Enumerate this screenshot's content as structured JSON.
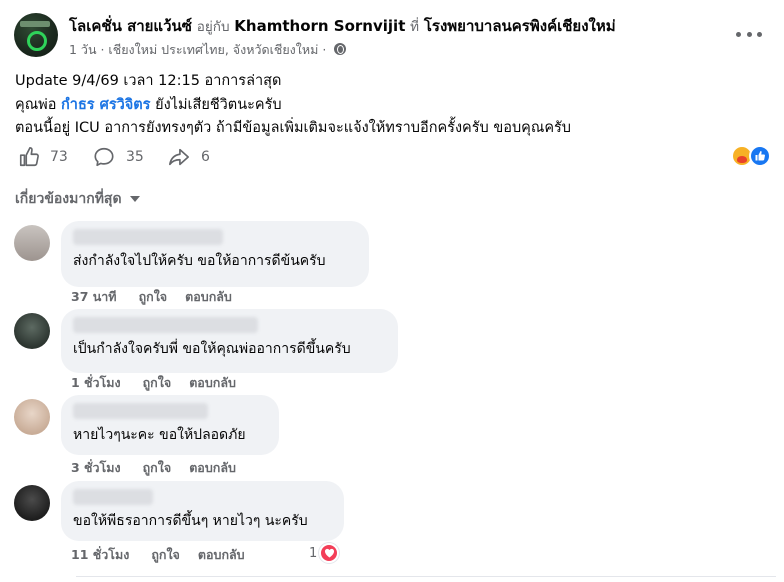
{
  "post": {
    "author": "โลเคชั่น สายแว้นซ์",
    "with_label": "อยู่กับ",
    "tagged": "Khamthorn Sornvijit",
    "at_label": "ที่",
    "place": "โรงพยาบาลนครพิงค์เชียงใหม่",
    "time": "1 วัน",
    "location": "· เชียงใหม่ ประเทศไทย, จังหวัดเชียงใหม่ ·",
    "line1": "Update 9/4/69 เวลา 12:15 อาการล่าสุด",
    "line2_prefix": "คุณพ่อ",
    "line2_mention": "กำธร ศรวิจิตร",
    "line2_suffix": "ยังไม่เสียชีวิตนะครับ",
    "line3": "ตอนนี้อยู่ ICU อาการยังทรงๆตัว ถ้ามีข้อมูลเพิ่มเติมจะแจ้งให้ทราบอีกครั้งครับ ขอบคุณครับ"
  },
  "stats": {
    "likes": "73",
    "comments": "35",
    "shares": "6"
  },
  "sort_label": "เกี่ยวข้องมากที่สุด",
  "comments": [
    {
      "text": "ส่งกำลังใจไปให้ครับ ขอให้อาการดีข้นครับ",
      "time": "37 นาที",
      "like": "ถูกใจ",
      "reply": "ตอบกลับ"
    },
    {
      "text": "เป็นกำลังใจครับพี่ ขอให้คุณพ่ออาการดีขึ้นครับ",
      "time": "1 ชั่วโมง",
      "like": "ถูกใจ",
      "reply": "ตอบกลับ"
    },
    {
      "text": "หายไวๆนะคะ ขอให้ปลอดภัย",
      "time": "3 ชั่วโมง",
      "like": "ถูกใจ",
      "reply": "ตอบกลับ"
    },
    {
      "text": "ขอให้พีธรอาการดีขึ้นๆ หายไวๆ นะครับ",
      "time": "11 ชั่วโมง",
      "like": "ถูกใจ",
      "reply": "ตอบกลับ",
      "reaction_count": "1"
    }
  ],
  "colors": {
    "accent": "#1b74e4",
    "muted": "#65676b",
    "bubble": "#f0f2f5",
    "heart": "#f33e58",
    "like": "#1877f2"
  },
  "icons": [
    "globe-icon",
    "more-icon",
    "like-icon",
    "comment-icon",
    "share-icon",
    "care-reaction-icon",
    "like-reaction-icon",
    "heart-icon",
    "chevron-down-icon"
  ]
}
